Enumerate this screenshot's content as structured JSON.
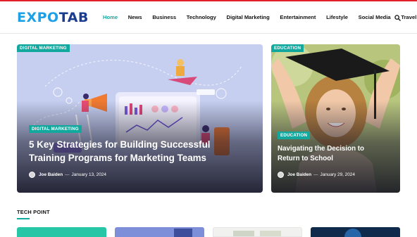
{
  "brand": {
    "logo_part1": "EXPO",
    "logo_part2": "TAB"
  },
  "nav": {
    "items": [
      "Home",
      "News",
      "Business",
      "Technology",
      "Digital Marketing",
      "Entertainment",
      "Lifestyle",
      "Social Media",
      "Travel"
    ],
    "active": "Home",
    "search_icon": "search-icon"
  },
  "featured": {
    "category_top": "DIGITAL MARKETING",
    "category_inline": "DIGITAL MARKETING",
    "title_line1": "5 Key Strategies for Building Successful",
    "title_line2": "Training Programs for Marketing Teams",
    "author": "Joe Baiden",
    "date": "January 13, 2024"
  },
  "side": {
    "category_top": "EDUCATION",
    "category_inline": "EDUCATION",
    "title_line1": "Navigating the Decision to",
    "title_line2": "Return to School",
    "author": "Joe Baiden",
    "date": "January 29, 2024"
  },
  "section": {
    "title": "TECH POINT"
  },
  "colors": {
    "accent": "#13a89e",
    "logo_light": "#1da1e6",
    "logo_dark": "#1b3d8f",
    "top_rule": "#e0202a"
  }
}
